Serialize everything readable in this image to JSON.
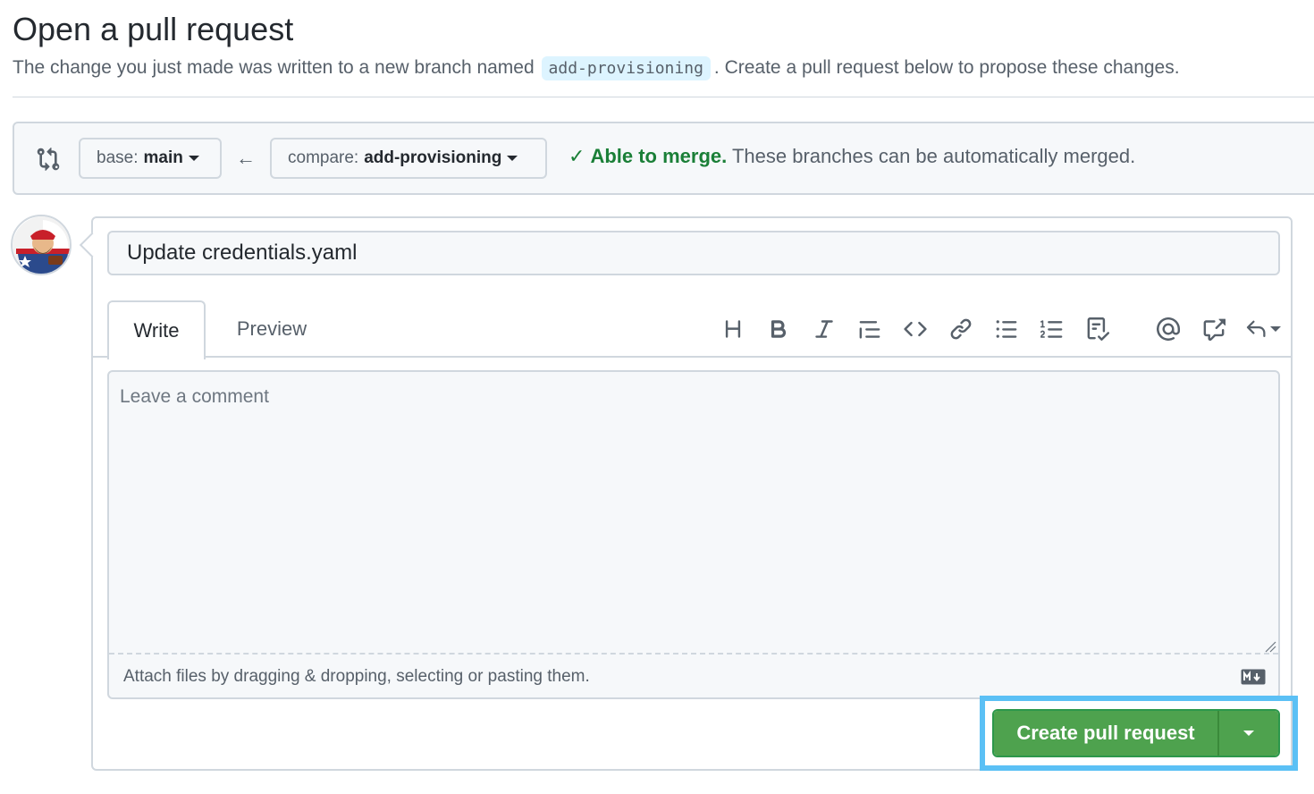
{
  "header": {
    "title": "Open a pull request",
    "subtitle_before": "The change you just made was written to a new branch named",
    "branch_name": "add-provisioning",
    "subtitle_after": ". Create a pull request below to propose these changes."
  },
  "compare": {
    "base_label": "base:",
    "base_value": "main",
    "compare_label": "compare:",
    "compare_value": "add-provisioning",
    "merge_status": "Able to merge.",
    "merge_desc": "These branches can be automatically merged."
  },
  "form": {
    "title_value": "Update credentials.yaml",
    "tabs": [
      "Write",
      "Preview"
    ],
    "comment_placeholder": "Leave a comment",
    "attach_text": "Attach files by dragging & dropping, selecting or pasting them."
  },
  "toolbar_icons": [
    "heading-icon",
    "bold-icon",
    "italic-icon",
    "quote-icon",
    "code-icon",
    "link-icon",
    "bulleted-list-icon",
    "numbered-list-icon",
    "task-list-icon",
    "mention-icon",
    "cross-reference-icon",
    "reply-icon"
  ],
  "actions": {
    "create_label": "Create pull request"
  },
  "colors": {
    "success": "#1a7f37",
    "create_button": "#4ea24e",
    "highlight": "#5bc0f5"
  }
}
